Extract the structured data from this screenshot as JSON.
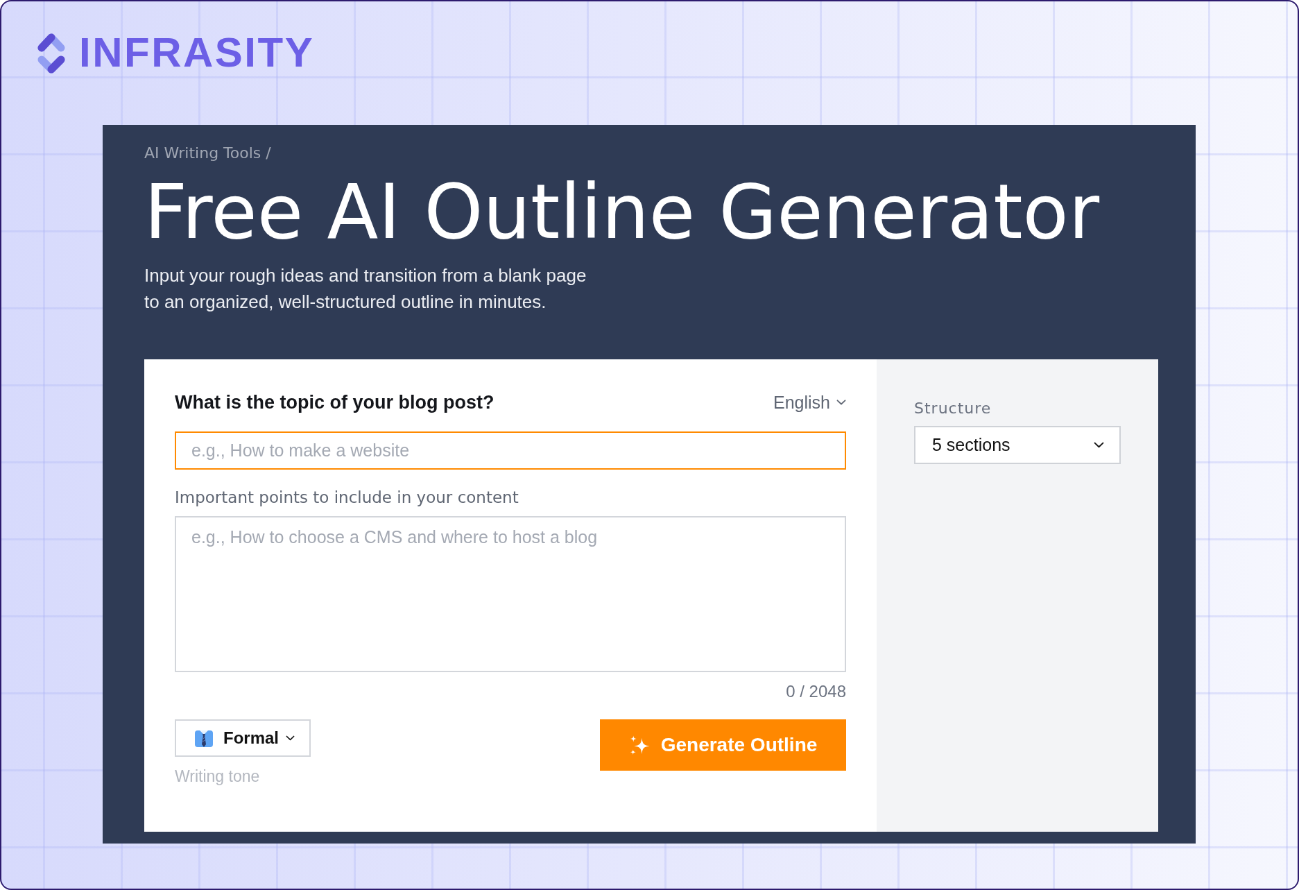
{
  "brand": {
    "name": "INFRASITY"
  },
  "hero": {
    "breadcrumb": "AI Writing Tools /",
    "title": "Free AI Outline Generator",
    "subtitle": "Input your rough ideas and transition from a blank page to an organized, well-structured outline in minutes."
  },
  "form": {
    "topic": {
      "label": "What is the topic of your blog post?",
      "placeholder": "e.g., How to make a website",
      "focused": true
    },
    "language": {
      "value": "English"
    },
    "points": {
      "label": "Important points to include in your content",
      "placeholder": "e.g., How to choose a CMS and where to host a blog",
      "counter": "0 / 2048"
    },
    "tone": {
      "value": "Formal",
      "caption": "Writing tone"
    },
    "generate_button": {
      "label": "Generate Outline"
    }
  },
  "structure": {
    "label": "Structure",
    "value": "5 sections"
  }
}
